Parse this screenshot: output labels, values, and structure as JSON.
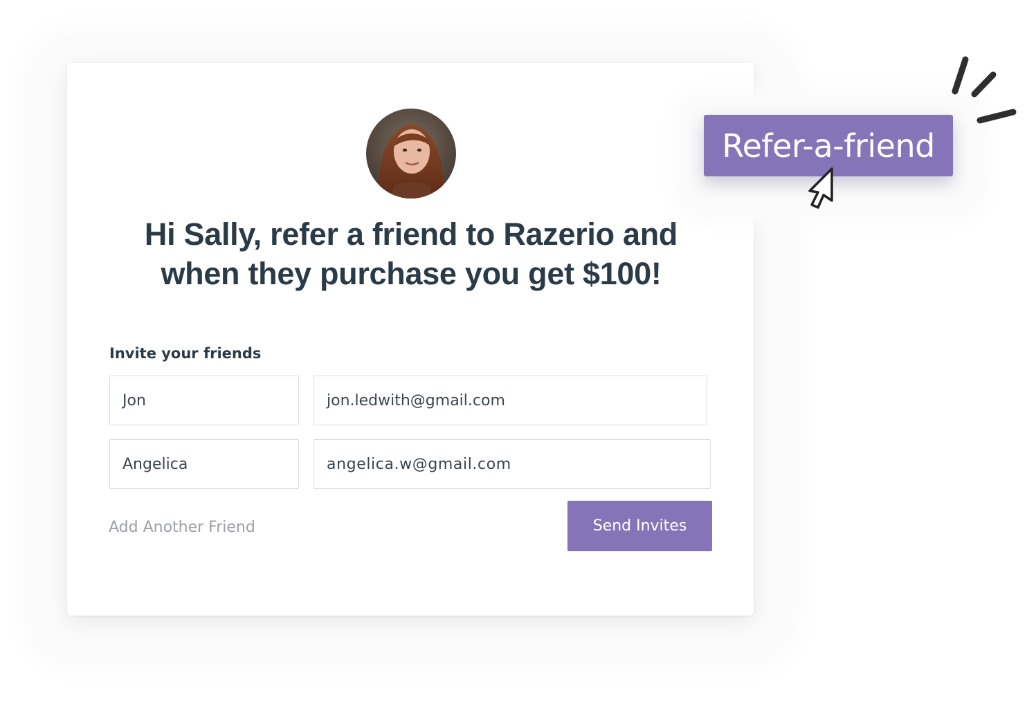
{
  "card": {
    "headline_line1": "Hi Sally, refer a friend to Razerio and",
    "headline_line2": "when they purchase you get $100!",
    "invite_label": "Invite your friends",
    "friends": [
      {
        "name": "Jon",
        "email": "jon.ledwith@gmail.com"
      },
      {
        "name": "Angelica",
        "email": "angelica.w@gmail.com"
      }
    ],
    "add_another_label": "Add Another Friend",
    "send_label": "Send Invites"
  },
  "badge": {
    "label": "Refer-a-friend"
  },
  "colors": {
    "accent": "#8574b7",
    "heading": "#2b3a47",
    "muted": "#9aa0a6",
    "border": "#dcdcdc"
  },
  "icons": {
    "avatar": "user-photo-avatar",
    "cursor": "pointer-cursor-icon",
    "sparkle": "click-sparkle-icon"
  }
}
